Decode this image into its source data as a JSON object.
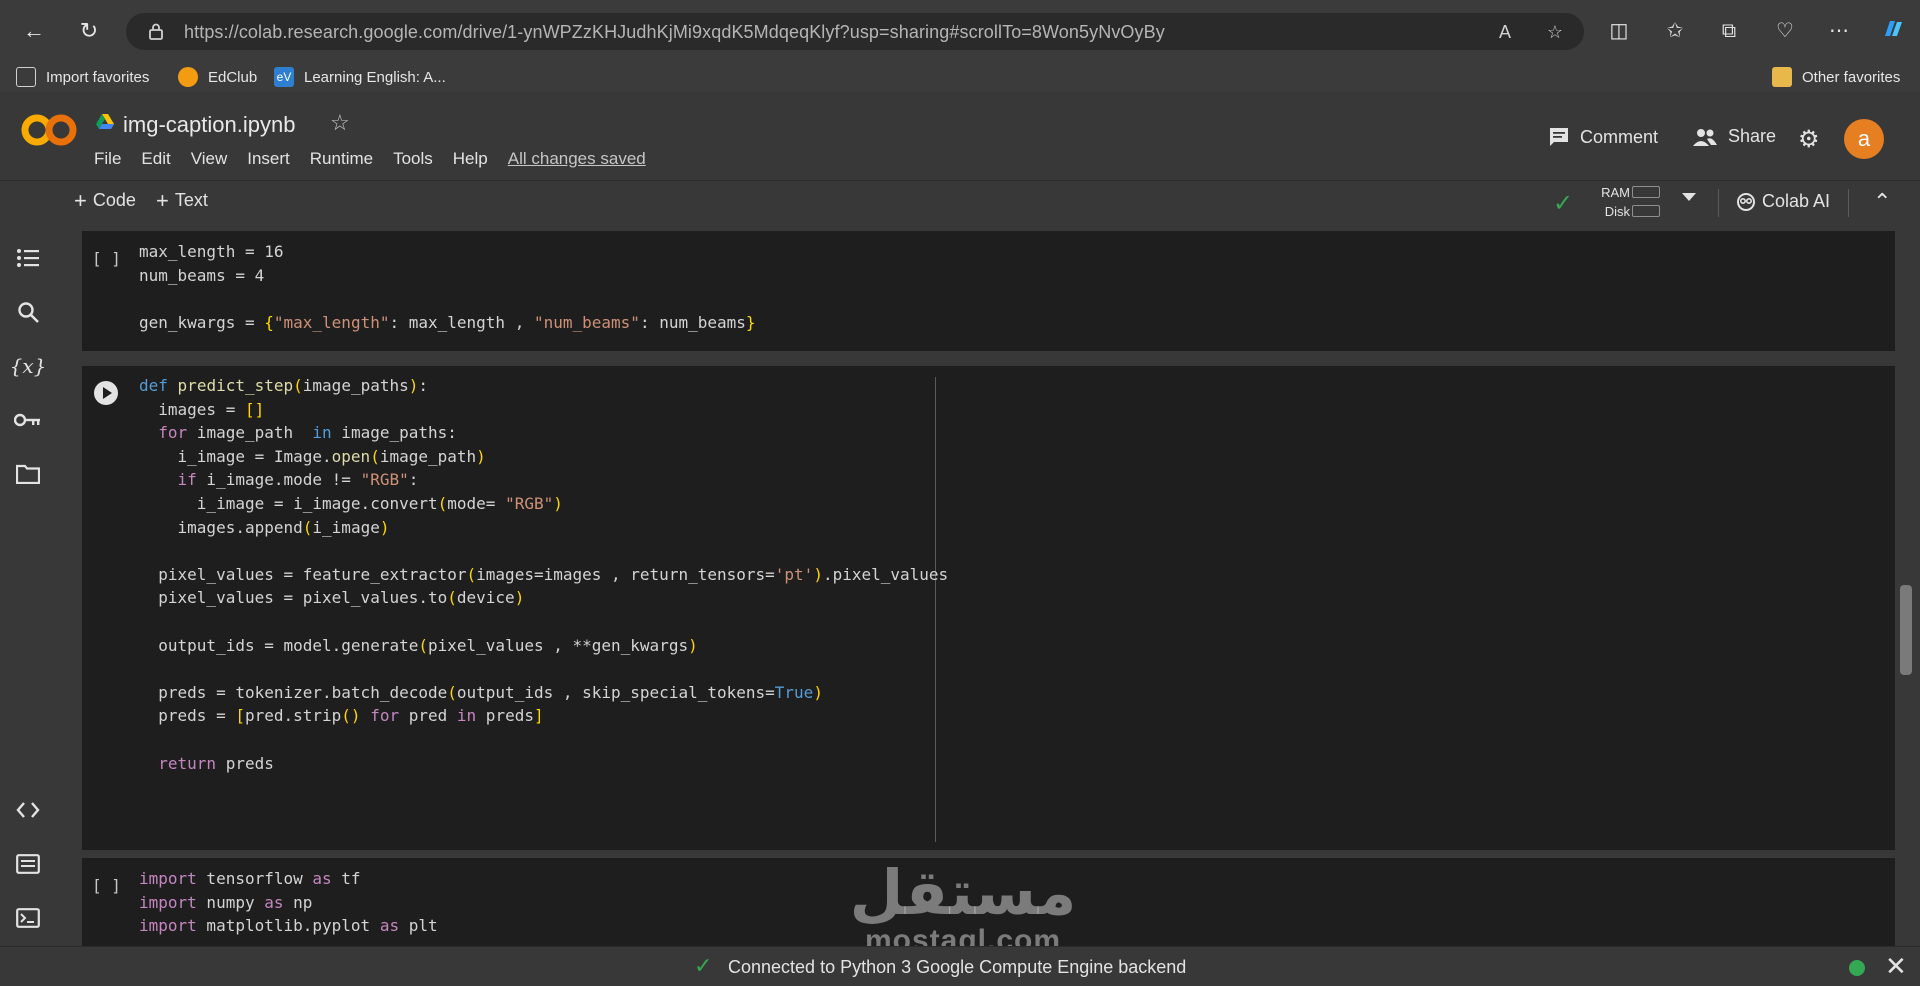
{
  "browser": {
    "url": "https://colab.research.google.com/drive/1-ynWPZzKHJudhKjMi9xqdK5MdqeqKlyf?usp=sharing#scrollTo=8Won5yNvOyBy",
    "favorites": [
      "Import favorites",
      "EdClub",
      "Learning English: A...",
      "Other favorites"
    ]
  },
  "notebook": {
    "title": "img-caption.ipynb",
    "menu": [
      "File",
      "Edit",
      "View",
      "Insert",
      "Runtime",
      "Tools",
      "Help"
    ],
    "saved_status": "All changes saved",
    "comment_label": "Comment",
    "share_label": "Share",
    "avatar_letter": "a"
  },
  "toolbar": {
    "code_label": "Code",
    "text_label": "Text",
    "ram_label": "RAM",
    "disk_label": "Disk",
    "colab_ai_label": "Colab AI"
  },
  "cells": [
    {
      "gutter": "[ ]",
      "type": "code",
      "run_state": "idle"
    },
    {
      "gutter": "",
      "type": "code",
      "run_state": "run-button"
    },
    {
      "gutter": "[ ]",
      "type": "code",
      "run_state": "idle"
    }
  ],
  "watermark": {
    "arabic": "مستقل",
    "latin": "mostaql.com"
  },
  "status_bar": {
    "text": "Connected to Python 3 Google Compute Engine backend"
  },
  "colors": {
    "accent_green": "#34a853",
    "avatar": "#e67e22",
    "background": "#1e1e1e",
    "chrome": "#383838"
  }
}
